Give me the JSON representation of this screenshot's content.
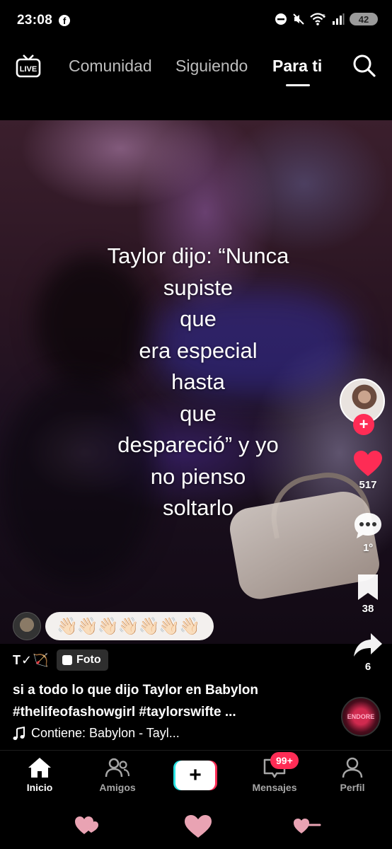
{
  "status_bar": {
    "time": "23:08",
    "facebook_icon": "f",
    "battery": "42",
    "signal_label": "5"
  },
  "top_nav": {
    "live_label": "LIVE",
    "tabs": [
      {
        "label": "Comunidad",
        "active": false
      },
      {
        "label": "Siguiendo",
        "active": false
      },
      {
        "label": "Para ti",
        "active": true
      }
    ]
  },
  "post": {
    "overlay_lines": [
      "Taylor dijo: “Nunca",
      "supiste",
      "que",
      "era especial",
      "hasta",
      "que",
      "despareció” y yo",
      "no pienso",
      "soltarlo"
    ],
    "comment_preview": "👋🏻👋🏻👋🏻👋🏻👋🏻👋🏻👋🏻",
    "author_signature": "T✓🏹",
    "type_badge": "Foto",
    "caption_line1": "si a todo lo que dijo Taylor en Babylon",
    "caption_line2": "#thelifeofashowgirl #taylorswifte ...",
    "music": "Contiene: Babylon - Tayl..."
  },
  "actions": {
    "likes": "517",
    "comments": "1º",
    "saves": "38",
    "shares": "6"
  },
  "disc_label": "ENDORE",
  "bottom_nav": {
    "home": "Inicio",
    "friends": "Amigos",
    "create": "+",
    "inbox": "Mensajes",
    "inbox_badge": "99+",
    "profile": "Perfil"
  },
  "colors": {
    "accent_red": "#fe2c55",
    "accent_cyan": "#29e2e3",
    "background": "#000000"
  }
}
